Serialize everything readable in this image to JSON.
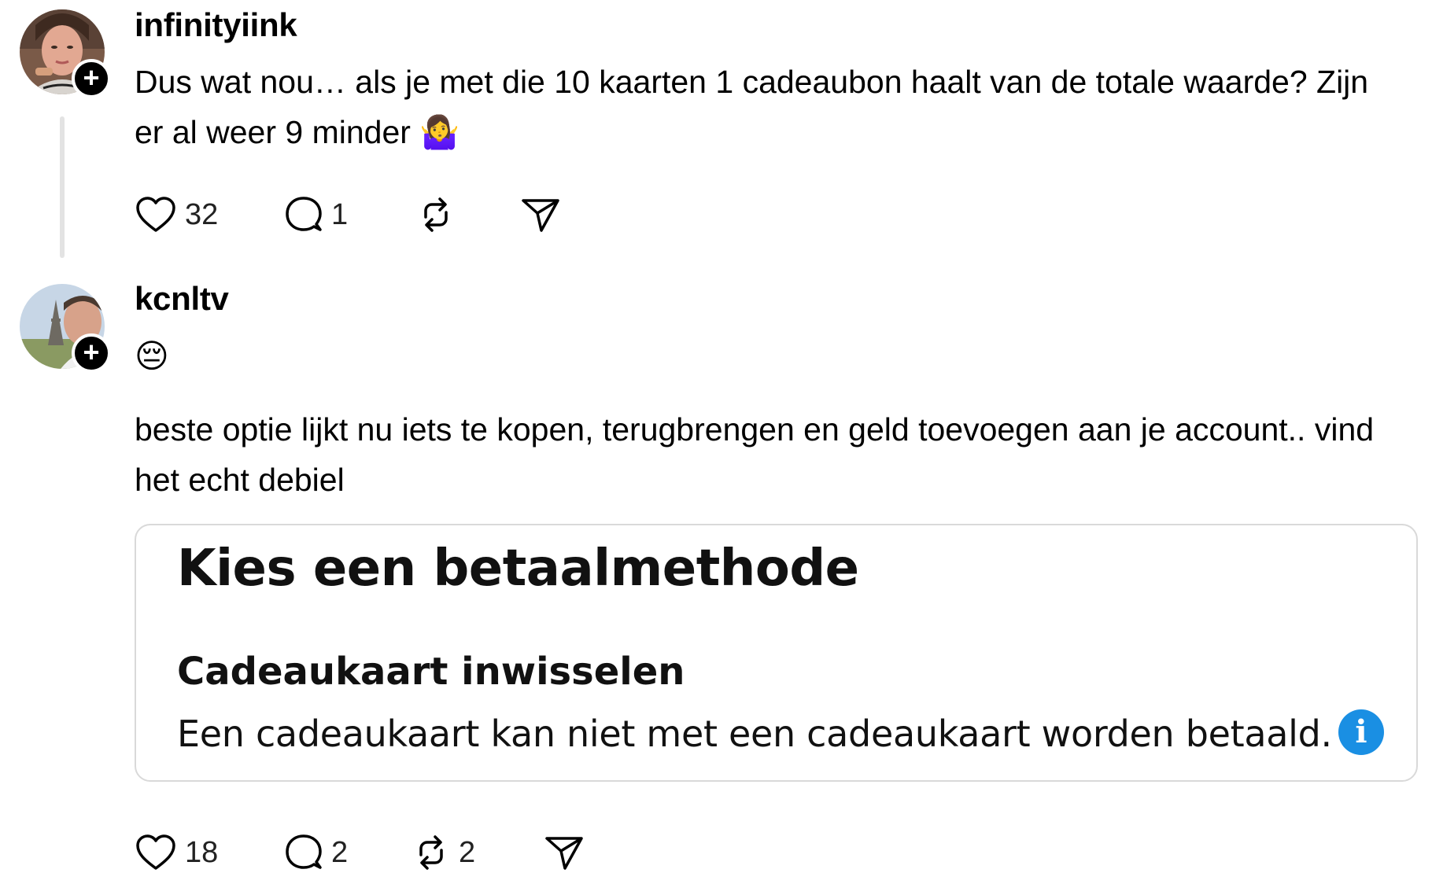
{
  "posts": [
    {
      "username": "infinityiink",
      "text": "Dus wat nou… als je met die 10 kaarten 1 cadeaubon haalt van de totale waarde? Zijn er al weer 9 minder 🤷‍♀️",
      "likes": "32",
      "replies": "1",
      "reposts": "",
      "follow_label": "+"
    },
    {
      "username": "kcnltv",
      "emoji": "😔",
      "text": "beste optie lijkt nu iets te kopen, terugbrengen en geld toevoegen aan je account.. vind het echt debiel",
      "likes": "18",
      "replies": "2",
      "reposts": "2",
      "follow_label": "+",
      "embed": {
        "title": "Kies een betaalmethode",
        "subtitle": "Cadeaukaart inwisselen",
        "body": "Een cadeaukaart kan niet met een cadeaukaart worden betaald.",
        "info_icon": "i",
        "info_color": "#1a8fe3"
      }
    }
  ],
  "icons": {
    "like": "heart-icon",
    "reply": "comment-icon",
    "repost": "repost-icon",
    "share": "send-icon",
    "info": "info-icon"
  }
}
